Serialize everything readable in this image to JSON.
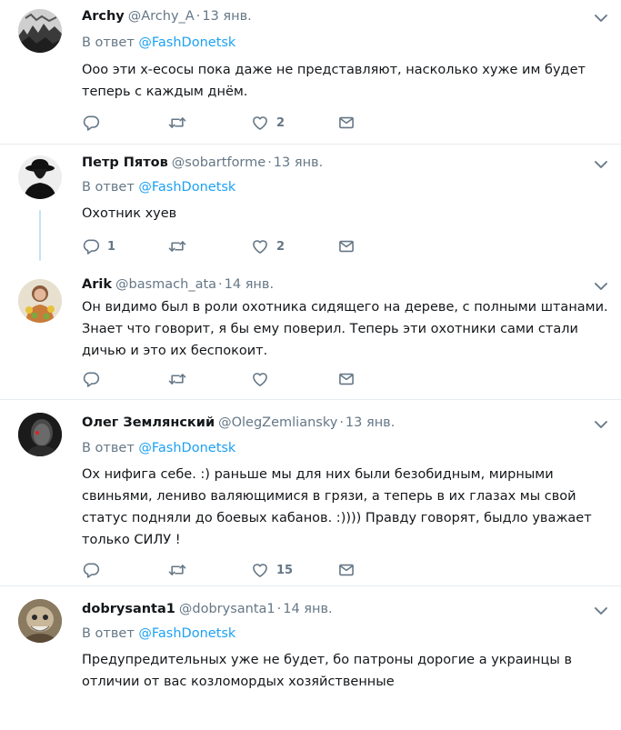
{
  "reply_prefix": "В ответ",
  "tweets": [
    {
      "name": "Archy",
      "handle": "@Archy_A",
      "date": "13 янв.",
      "reply_to": "@FashDonetsk",
      "text": "Ооо эти х-есосы пока даже не представляют, насколько хуже им будет теперь с каждым днём.",
      "replies": "",
      "retweets": "",
      "likes": "2"
    },
    {
      "name": "Петр Пятов",
      "handle": "@sobartforme",
      "date": "13 янв.",
      "reply_to": "@FashDonetsk",
      "text": "Охотник хуев",
      "replies": "1",
      "retweets": "",
      "likes": "2"
    },
    {
      "name": "Arik",
      "handle": "@basmach_ata",
      "date": "14 янв.",
      "reply_to": "",
      "text": "Он видимо был в роли охотника сидящего на дереве, с полными штанами. Знает что говорит, я бы ему поверил. Теперь эти охотники сами стали дичью и это их беспокоит.",
      "replies": "",
      "retweets": "",
      "likes": ""
    },
    {
      "name": "Олег Землянский",
      "handle": "@OlegZemliansky",
      "date": "13 янв.",
      "reply_to": "@FashDonetsk",
      "text": "Ох нифига себе. :) раньше мы для них были безобидным, мирными свиньями, лениво валяющимися в грязи, а теперь в их глазах мы свой статус подняли до боевых кабанов. :)))) Правду говорят, быдло уважает только СИЛУ !",
      "replies": "",
      "retweets": "",
      "likes": "15"
    },
    {
      "name": "dobrysanta1",
      "handle": "@dobrysanta1",
      "date": "14 янв.",
      "reply_to": "@FashDonetsk",
      "text": "Предупредительных уже не будет, бо патроны дорогие а украинцы в отличии от вас козломордых хозяйственные",
      "replies": "",
      "retweets": "",
      "likes": ""
    }
  ],
  "colors": {
    "text": "#14171a",
    "muted": "#657786",
    "link": "#1da1f2",
    "divider": "#e6ecf0",
    "thread_line": "#c4e3f7"
  },
  "icons": [
    "reply-icon",
    "retweet-icon",
    "like-icon",
    "message-icon",
    "chevron-down-icon"
  ]
}
